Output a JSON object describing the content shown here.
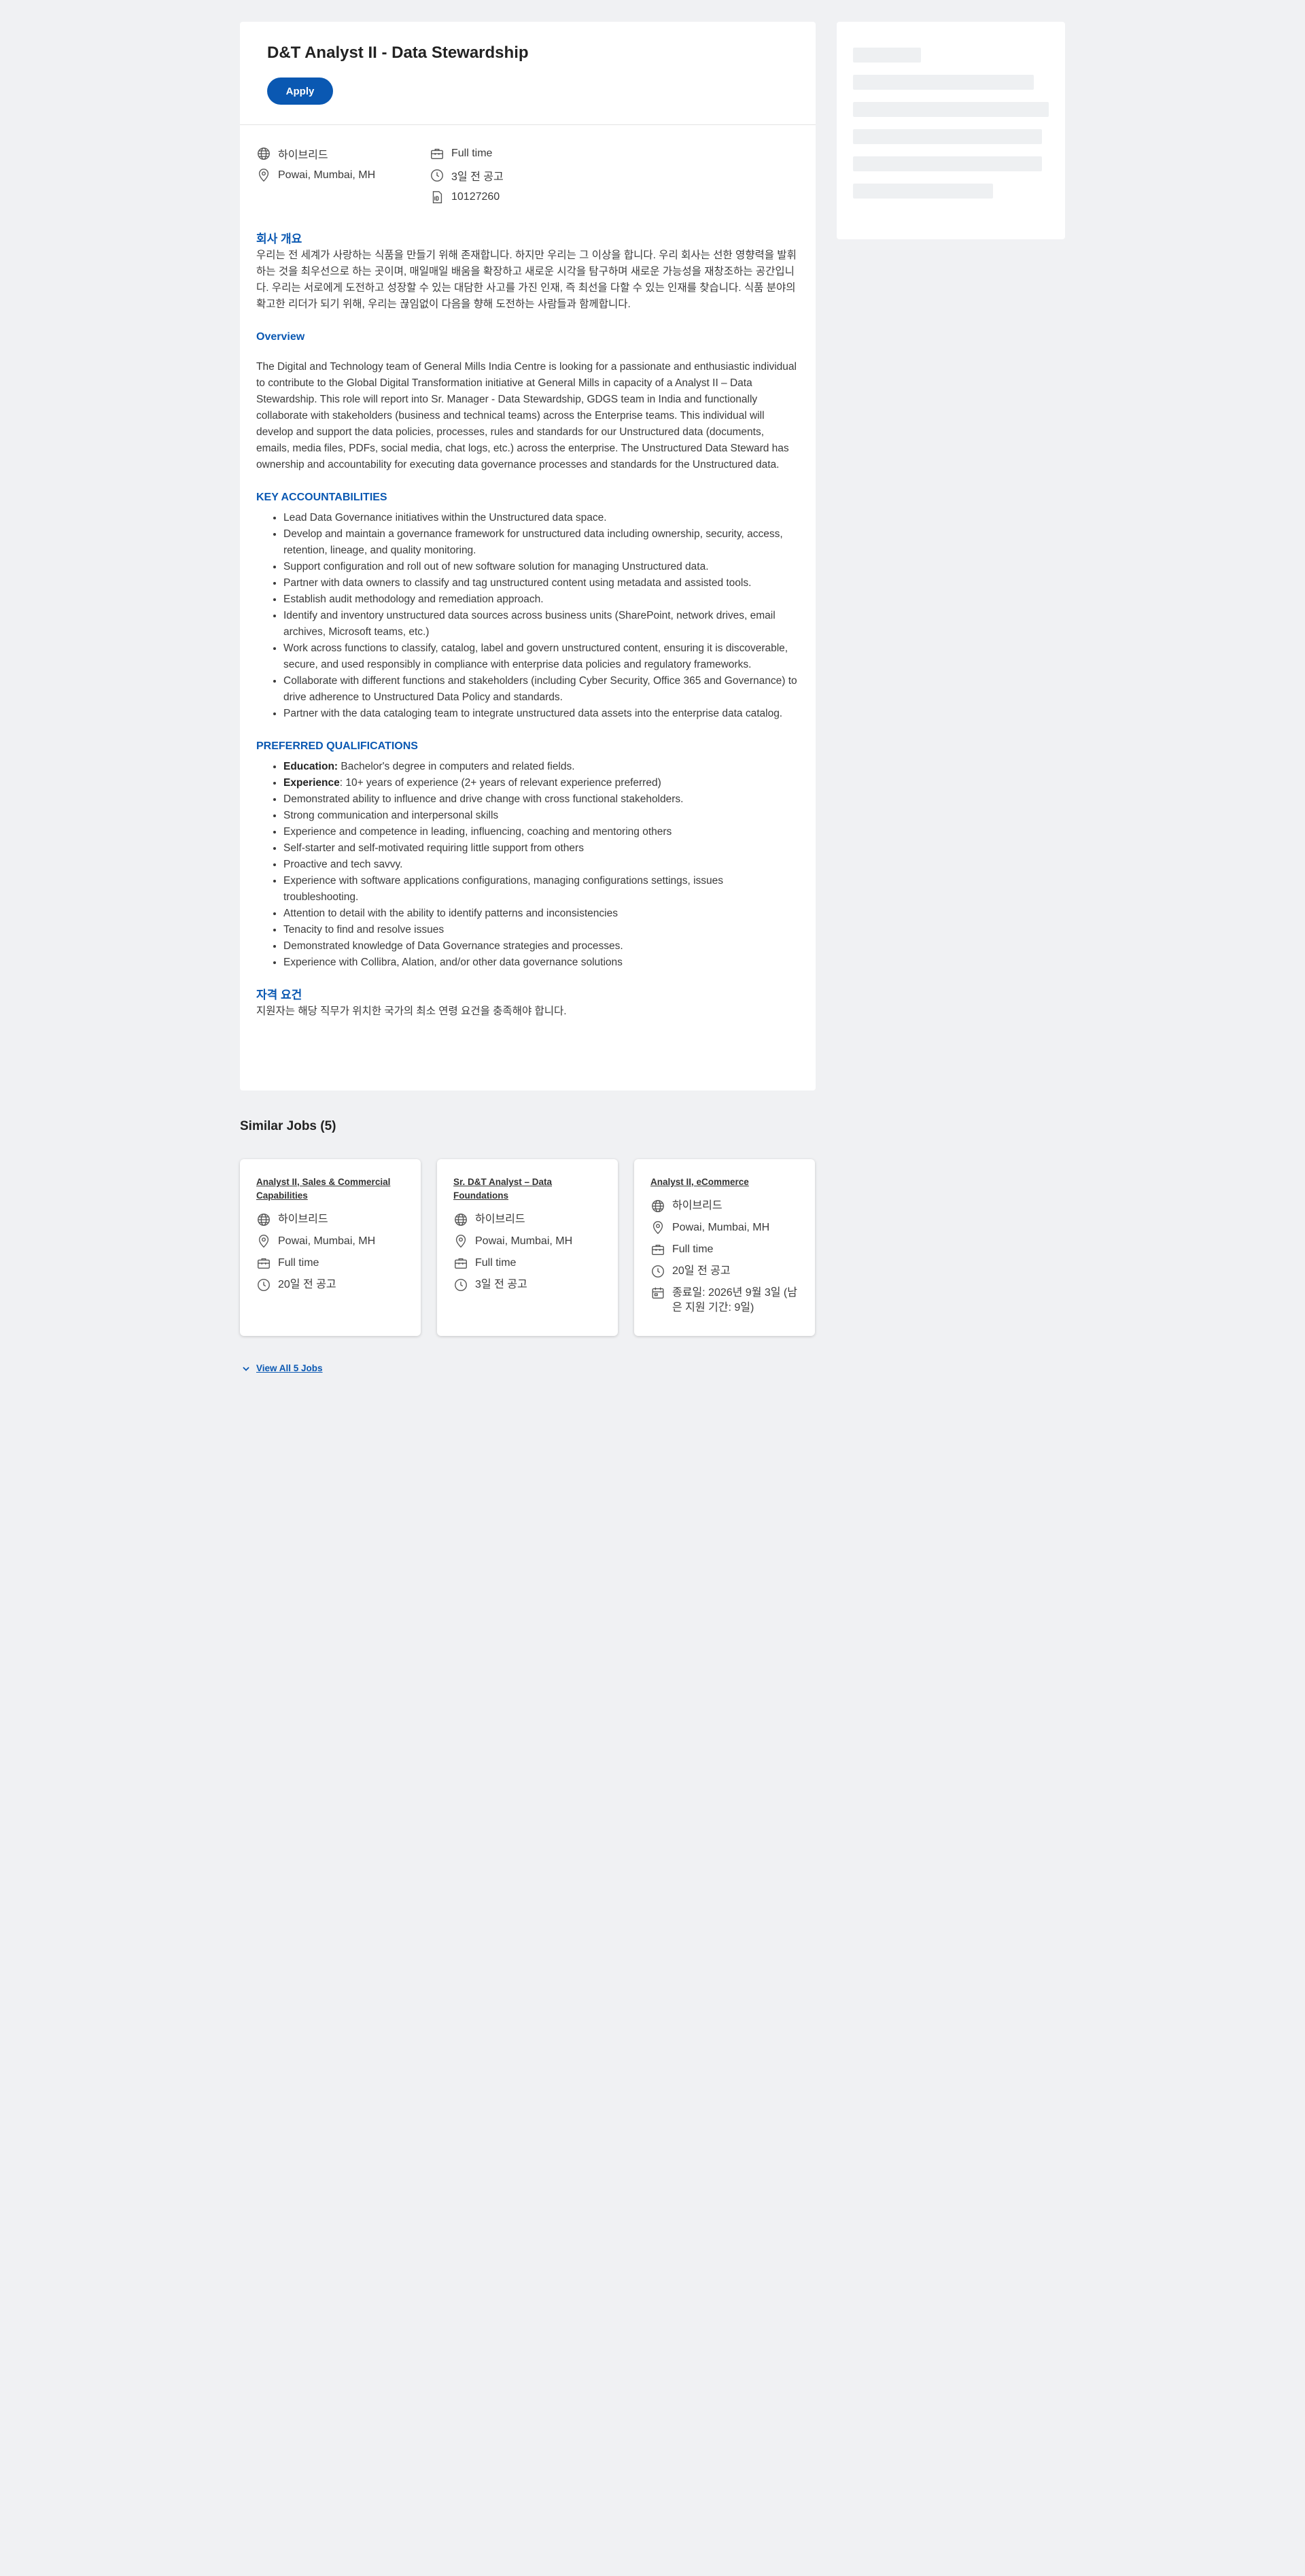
{
  "job": {
    "title": "D&T Analyst II - Data Stewardship",
    "apply_label": "Apply",
    "meta": {
      "location_type": "하이브리드",
      "location": "Powai, Mumbai, MH",
      "employment_type": "Full time",
      "posted": "3일 전 공고",
      "job_id": "10127260"
    },
    "company_overview": {
      "heading": "회사 개요",
      "text": "우리는 전 세계가 사랑하는 식품을 만들기 위해 존재합니다. 하지만 우리는 그 이상을 합니다. 우리 회사는 선한 영향력을 발휘하는 것을 최우선으로 하는 곳이며, 매일매일 배움을 확장하고 새로운 시각을 탐구하며 새로운 가능성을 재창조하는 공간입니다. 우리는 서로에게 도전하고 성장할 수 있는 대담한 사고를 가진 인재, 즉 최선을 다할 수 있는 인재를 찾습니다. 식품 분야의 확고한 리더가 되기 위해, 우리는 끊임없이 다음을 향해 도전하는 사람들과 함께합니다."
    },
    "overview": {
      "heading": "Overview",
      "text": "The Digital and Technology team of General Mills India Centre is looking for a passionate and enthusiastic individual to contribute to the Global Digital Transformation initiative at General Mills in capacity of a Analyst II – Data Stewardship. This role will report into Sr. Manager - Data Stewardship, GDGS team in India and functionally collaborate with stakeholders (business and technical teams) across the Enterprise teams. This individual will develop and support the data policies, processes, rules and standards for our Unstructured data (documents, emails, media files, PDFs, social media, chat logs, etc.) across the enterprise.  The Unstructured Data Steward has ownership and accountability for executing data governance processes and standards for the Unstructured data."
    },
    "key_accountabilities": {
      "heading": "KEY ACCOUNTABILITIES",
      "items": [
        "Lead Data Governance initiatives within the Unstructured data space.",
        "Develop and maintain a governance framework for unstructured data including ownership, security, access, retention, lineage, and quality monitoring.",
        "Support configuration and roll out of new software solution for managing Unstructured data.",
        "Partner with data owners to classify and tag unstructured content using metadata and assisted tools.",
        "Establish audit methodology and remediation approach.",
        "Identify and inventory unstructured data sources across business units (SharePoint, network drives, email archives, Microsoft teams, etc.)",
        "Work across functions to classify, catalog, label and govern unstructured content, ensuring it is discoverable, secure, and used responsibly in compliance with enterprise data policies and regulatory frameworks.",
        "Collaborate with different functions and stakeholders (including Cyber Security, Office 365 and Governance) to drive adherence to Unstructured Data Policy and standards.",
        "Partner with the data cataloging team to integrate unstructured data assets into the enterprise data catalog."
      ]
    },
    "preferred_qualifications": {
      "heading": "PREFERRED QUALIFICATIONS",
      "education_label": "Education:",
      "education_text": " Bachelor's degree in computers and related fields.",
      "experience_label": "Experience",
      "experience_text": ": 10+ years of experience (2+ years of relevant experience preferred)",
      "items": [
        "Demonstrated ability to influence and drive change with cross functional stakeholders.",
        "Strong communication and interpersonal skills",
        "Experience and competence in leading, influencing, coaching and mentoring others",
        "Self-starter and self-motivated requiring little support from others",
        "Proactive and tech savvy.",
        "Experience with software applications configurations, managing configurations settings, issues troubleshooting.",
        "Attention to detail with the ability to identify patterns and inconsistencies",
        "Tenacity to find and resolve issues",
        "Demonstrated knowledge of Data Governance strategies and processes.",
        "Experience with Collibra, Alation, and/or other data governance solutions"
      ]
    },
    "qualification_requirements": {
      "heading": "자격 요건",
      "text": "지원자는 해당 직무가 위치한 국가의 최소 연령 요건을 충족해야 합니다."
    }
  },
  "similar_jobs": {
    "heading": "Similar Jobs (5)",
    "view_all_label": "View All 5 Jobs",
    "cards": [
      {
        "title": "Analyst II, Sales & Commercial Capabilities",
        "location_type": "하이브리드",
        "location": "Powai, Mumbai, MH",
        "employment_type": "Full time",
        "posted": "20일 전 공고"
      },
      {
        "title": "Sr. D&T Analyst – Data Foundations",
        "location_type": "하이브리드",
        "location": "Powai, Mumbai, MH",
        "employment_type": "Full time",
        "posted": "3일 전 공고"
      },
      {
        "title": "Analyst II, eCommerce",
        "location_type": "하이브리드",
        "location": "Powai, Mumbai, MH",
        "employment_type": "Full time",
        "posted": "20일 전 공고",
        "closing": "종료일: 2026년 9월 3일 (남은 지원 기간: 9일)"
      }
    ]
  },
  "icons": {
    "location_type": "globe-icon",
    "location": "location-pin-icon",
    "employment_type": "briefcase-icon",
    "posted": "clock-icon",
    "job_id": "id-badge-icon",
    "closing": "calendar-icon",
    "view_all": "chevron-down-icon"
  },
  "colors": {
    "accent": "#0a58b2",
    "background": "#f0f1f3",
    "card": "#ffffff"
  }
}
